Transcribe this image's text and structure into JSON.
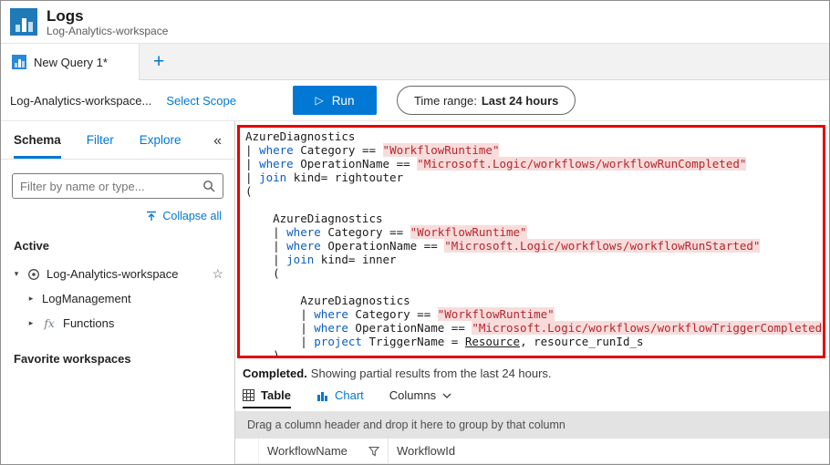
{
  "header": {
    "title": "Logs",
    "subtitle": "Log-Analytics-workspace"
  },
  "query_tabs": {
    "active": "New Query 1*"
  },
  "toolbar": {
    "scope": "Log-Analytics-workspace...",
    "select_scope": "Select Scope",
    "run": "Run",
    "time_range_label": "Time range:",
    "time_range_value": "Last 24 hours"
  },
  "sidebar": {
    "tabs": [
      {
        "label": "Schema"
      },
      {
        "label": "Filter"
      },
      {
        "label": "Explore"
      }
    ],
    "filter_placeholder": "Filter by name or type...",
    "collapse_all": "Collapse all",
    "active_heading": "Active",
    "tree": [
      {
        "label": "Log-Analytics-workspace"
      },
      {
        "label": "LogManagement"
      },
      {
        "label": "Functions"
      }
    ],
    "favorites_heading": "Favorite workspaces"
  },
  "editor": {
    "lines": [
      [
        {
          "c": "p",
          "v": "AzureDiagnostics"
        }
      ],
      [
        {
          "c": "p",
          "v": "| "
        },
        {
          "c": "k",
          "v": "where"
        },
        {
          "c": "p",
          "v": " Category == "
        },
        {
          "c": "s",
          "v": "\"WorkflowRuntime\""
        }
      ],
      [
        {
          "c": "p",
          "v": "| "
        },
        {
          "c": "k",
          "v": "where"
        },
        {
          "c": "p",
          "v": " OperationName == "
        },
        {
          "c": "s",
          "v": "\"Microsoft.Logic/workflows/workflowRunCompleted\""
        }
      ],
      [
        {
          "c": "p",
          "v": "| "
        },
        {
          "c": "k",
          "v": "join"
        },
        {
          "c": "p",
          "v": " kind= rightouter"
        }
      ],
      [
        {
          "c": "p",
          "v": "("
        }
      ],
      [],
      [
        {
          "c": "p",
          "v": "    AzureDiagnostics"
        }
      ],
      [
        {
          "c": "p",
          "v": "    | "
        },
        {
          "c": "k",
          "v": "where"
        },
        {
          "c": "p",
          "v": " Category == "
        },
        {
          "c": "s",
          "v": "\"WorkflowRuntime\""
        }
      ],
      [
        {
          "c": "p",
          "v": "    | "
        },
        {
          "c": "k",
          "v": "where"
        },
        {
          "c": "p",
          "v": " OperationName == "
        },
        {
          "c": "s",
          "v": "\"Microsoft.Logic/workflows/workflowRunStarted\""
        }
      ],
      [
        {
          "c": "p",
          "v": "    | "
        },
        {
          "c": "k",
          "v": "join"
        },
        {
          "c": "p",
          "v": " kind= inner"
        }
      ],
      [
        {
          "c": "p",
          "v": "    ("
        }
      ],
      [],
      [
        {
          "c": "p",
          "v": "        AzureDiagnostics"
        }
      ],
      [
        {
          "c": "p",
          "v": "        | "
        },
        {
          "c": "k",
          "v": "where"
        },
        {
          "c": "p",
          "v": " Category == "
        },
        {
          "c": "s",
          "v": "\"WorkflowRuntime\""
        }
      ],
      [
        {
          "c": "p",
          "v": "        | "
        },
        {
          "c": "k",
          "v": "where"
        },
        {
          "c": "p",
          "v": " OperationName == "
        },
        {
          "c": "s",
          "v": "\"Microsoft.Logic/workflows/workflowTriggerCompleted"
        }
      ],
      [
        {
          "c": "p",
          "v": "        | "
        },
        {
          "c": "k",
          "v": "project"
        },
        {
          "c": "p",
          "v": " TriggerName = "
        },
        {
          "c": "u",
          "v": "Resource"
        },
        {
          "c": "p",
          "v": ", resource_runId_s"
        }
      ],
      [
        {
          "c": "p",
          "v": "    )"
        }
      ]
    ]
  },
  "results": {
    "status_strong": "Completed.",
    "status_text": "Showing partial results from the last 24 hours.",
    "tab_table": "Table",
    "tab_chart": "Chart",
    "columns_menu": "Columns",
    "group_hint": "Drag a column header and drop it here to group by that column",
    "columns": [
      "WorkflowName",
      "WorkflowId"
    ]
  },
  "icons": {
    "play": "▷",
    "add_tab": "+",
    "collapse_pane": "«",
    "caret_expanded": "▾",
    "caret_collapsed": "▸",
    "star": "☆",
    "fx": "fx"
  },
  "colors": {
    "accent": "#0078d4",
    "highlight_border": "#e50000",
    "string_text": "#b3282d",
    "keyword_text": "#0b5dc0"
  }
}
